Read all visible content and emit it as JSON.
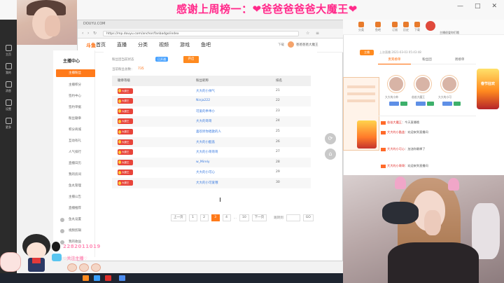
{
  "banner": {
    "thanks_text": "感谢上周榜一：❤爸爸爸爸爸大魔王❤",
    "controls": [
      "—",
      "□",
      "✕"
    ]
  },
  "left_taskbar": {
    "items": [
      "主页",
      "我的",
      "消息",
      "设置",
      "更多"
    ]
  },
  "browser": {
    "tab_title": "DOUYU.COM",
    "url": "https://mp.douyu.com/anchor/fanbadge/index",
    "site_logo": "斗鱼",
    "nav": [
      "首页",
      "直播",
      "分类",
      "视频",
      "游戏",
      "鱼吧"
    ],
    "download_label": "下载",
    "username": "爸爸爸爸大魔王"
  },
  "sidebar": {
    "title": "主播中心",
    "active_label": "主播粉丝",
    "items": [
      "主播中心",
      "主播积分",
      "签约中心",
      "签约单据",
      "粉丝徽章",
      "积分商城",
      "互动有礼",
      "人气排行",
      "直播日历",
      "我的房间",
      "鱼丸管理",
      "主播公告",
      "直播推荐",
      "鱼丸设置",
      "视频剪辑",
      "我的收益"
    ]
  },
  "content": {
    "status_label": "粉丝团当前状态",
    "status_badge": "已开通",
    "apply_button": "开启",
    "count_label": "当前粉丝总数：",
    "count_value": "735",
    "table": {
      "headers": [
        "徽章等级",
        "粉丝昵称",
        "排名"
      ],
      "rows": [
        {
          "medal": "大魔王",
          "name": "大大的小帅气",
          "rank": "21"
        },
        {
          "medal": "大魔王",
          "name": "Ninja222",
          "rank": "22"
        },
        {
          "medal": "大魔王",
          "name": "可爱的乖乖小",
          "rank": "23"
        },
        {
          "medal": "大魔王",
          "name": "大大的哥哥",
          "rank": "24"
        },
        {
          "medal": "大魔王",
          "name": "喜欢听你唱歌的人",
          "rank": "25"
        },
        {
          "medal": "大魔王",
          "name": "大大的小酷盖",
          "rank": "26"
        },
        {
          "medal": "大魔王",
          "name": "大大的小哥哥哥",
          "rank": "27"
        },
        {
          "medal": "大魔王",
          "name": "w_Mirely",
          "rank": "28"
        },
        {
          "medal": "大魔王",
          "name": "大大的小可心",
          "rank": "29"
        },
        {
          "medal": "大魔王",
          "name": "大大的小可爱哦",
          "rank": "30"
        }
      ]
    },
    "pager": {
      "prev": "上一页",
      "pages": [
        "1",
        "2",
        "3",
        "4"
      ],
      "active_page": "3",
      "ellipsis": "…",
      "last": "10",
      "next": "下一页",
      "jump_label": "跳转到",
      "go": "GO"
    }
  },
  "right_panel": {
    "icons": [
      "分类",
      "鱼吧",
      "订阅",
      "历史",
      "下载"
    ],
    "streamer_name": "主播很爱你们哦",
    "tag": "主播",
    "time_text": "上次直播 2021-03-03 05:43:48",
    "tabs": [
      "贵宾榜单",
      "粉丝团",
      "周榜单"
    ],
    "rank_names": [
      "大大的小帅",
      "爸爸大魔王",
      "大大的小可"
    ],
    "chat": [
      {
        "name": "爸爸大魔王",
        "text": "今天直播哦"
      },
      {
        "name": "大大的小酷盖",
        "text": "欢迎来到直播间"
      },
      {
        "name": "大大的小可心",
        "text": "加油你最棒了"
      },
      {
        "name": "大大的小哥哥",
        "text": "欢迎来到直播间"
      }
    ],
    "ad_text": "春节狂欢"
  },
  "stickers": {
    "qq_number": "2282011019",
    "sticker_text": "♡关注主播♡"
  },
  "colors": {
    "accent": "#ff7a1a",
    "banner_text": "#ff2a8a",
    "link": "#3a7be0"
  }
}
